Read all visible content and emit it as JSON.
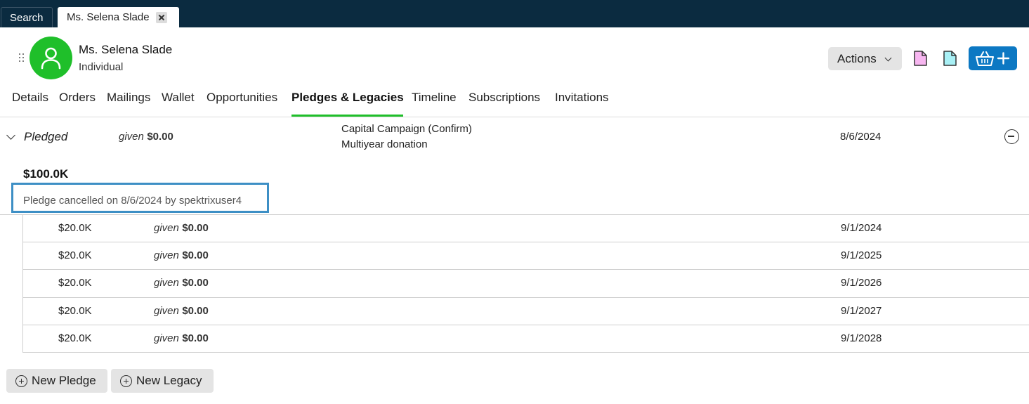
{
  "top_tabs": [
    {
      "label": "Search"
    },
    {
      "label": "Ms. Selena Slade"
    }
  ],
  "header": {
    "name": "Ms. Selena Slade",
    "type": "Individual",
    "actions_label": "Actions"
  },
  "nav": [
    {
      "label": "Details"
    },
    {
      "label": "Orders"
    },
    {
      "label": "Mailings"
    },
    {
      "label": "Wallet"
    },
    {
      "label": "Opportunities"
    },
    {
      "label": "Pledges & Legacies"
    },
    {
      "label": "Timeline"
    },
    {
      "label": "Subscriptions"
    },
    {
      "label": "Invitations"
    }
  ],
  "pledge": {
    "status": "Pledged",
    "given_label": "given",
    "given_amount": "$0.00",
    "campaign": "Capital Campaign (Confirm)",
    "description": "Multiyear donation",
    "date": "8/6/2024",
    "total": "$100.0K",
    "cancel_note": "Pledge cancelled on 8/6/2024 by spektrixuser4"
  },
  "installments": [
    {
      "amount": "$20.0K",
      "given_label": "given",
      "given": "$0.00",
      "date": "9/1/2024"
    },
    {
      "amount": "$20.0K",
      "given_label": "given",
      "given": "$0.00",
      "date": "9/1/2025"
    },
    {
      "amount": "$20.0K",
      "given_label": "given",
      "given": "$0.00",
      "date": "9/1/2026"
    },
    {
      "amount": "$20.0K",
      "given_label": "given",
      "given": "$0.00",
      "date": "9/1/2027"
    },
    {
      "amount": "$20.0K",
      "given_label": "given",
      "given": "$0.00",
      "date": "9/1/2028"
    }
  ],
  "buttons": {
    "new_pledge": "New Pledge",
    "new_legacy": "New Legacy"
  },
  "colors": {
    "topbar": "#0b2b40",
    "avatar": "#1fbf2a",
    "nav_active_underline": "#1fbf2a",
    "primary_button": "#0c78c3",
    "highlight_border": "#3d8fc5",
    "doc_icon_pink": "#f7b6f0",
    "doc_icon_cyan": "#a8f0f5"
  },
  "icons": [
    "drag-handle-icon",
    "user-icon",
    "chevron-down-icon",
    "document-icon",
    "basket-add-icon",
    "collapse-chevron-icon",
    "minus-circle-icon",
    "plus-circle-icon",
    "close-icon"
  ]
}
